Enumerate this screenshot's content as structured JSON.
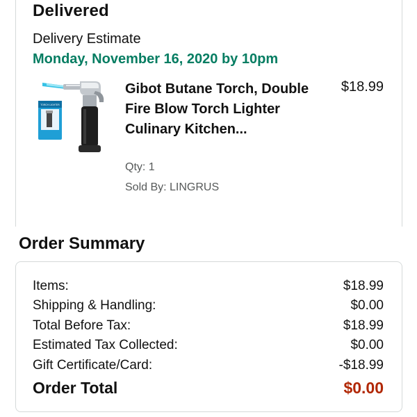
{
  "shipment": {
    "status": "Delivered",
    "estimate_label": "Delivery Estimate",
    "estimate_date": "Monday, November 16, 2020 by 10pm",
    "estimate_color": "#067d62"
  },
  "item": {
    "name": "Gibot Butane Torch, Double Fire Blow Torch Lighter Culinary Kitchen...",
    "price": "$18.99",
    "qty": "Qty: 1",
    "seller": "Sold By: LINGRUS",
    "image_icon": "butane-torch-product-image",
    "image_box_text": "TORCH LIGHTER"
  },
  "summary": {
    "heading": "Order Summary",
    "rows": [
      {
        "label": "Items:",
        "value": "$18.99"
      },
      {
        "label": "Shipping & Handling:",
        "value": "$0.00"
      },
      {
        "label": "Total Before Tax:",
        "value": "$18.99"
      },
      {
        "label": "Estimated Tax Collected:",
        "value": "$0.00"
      },
      {
        "label": "Gift Certificate/Card:",
        "value": "-$18.99"
      }
    ],
    "total_label": "Order Total",
    "total_value": "$0.00",
    "total_color": "#b12704"
  }
}
